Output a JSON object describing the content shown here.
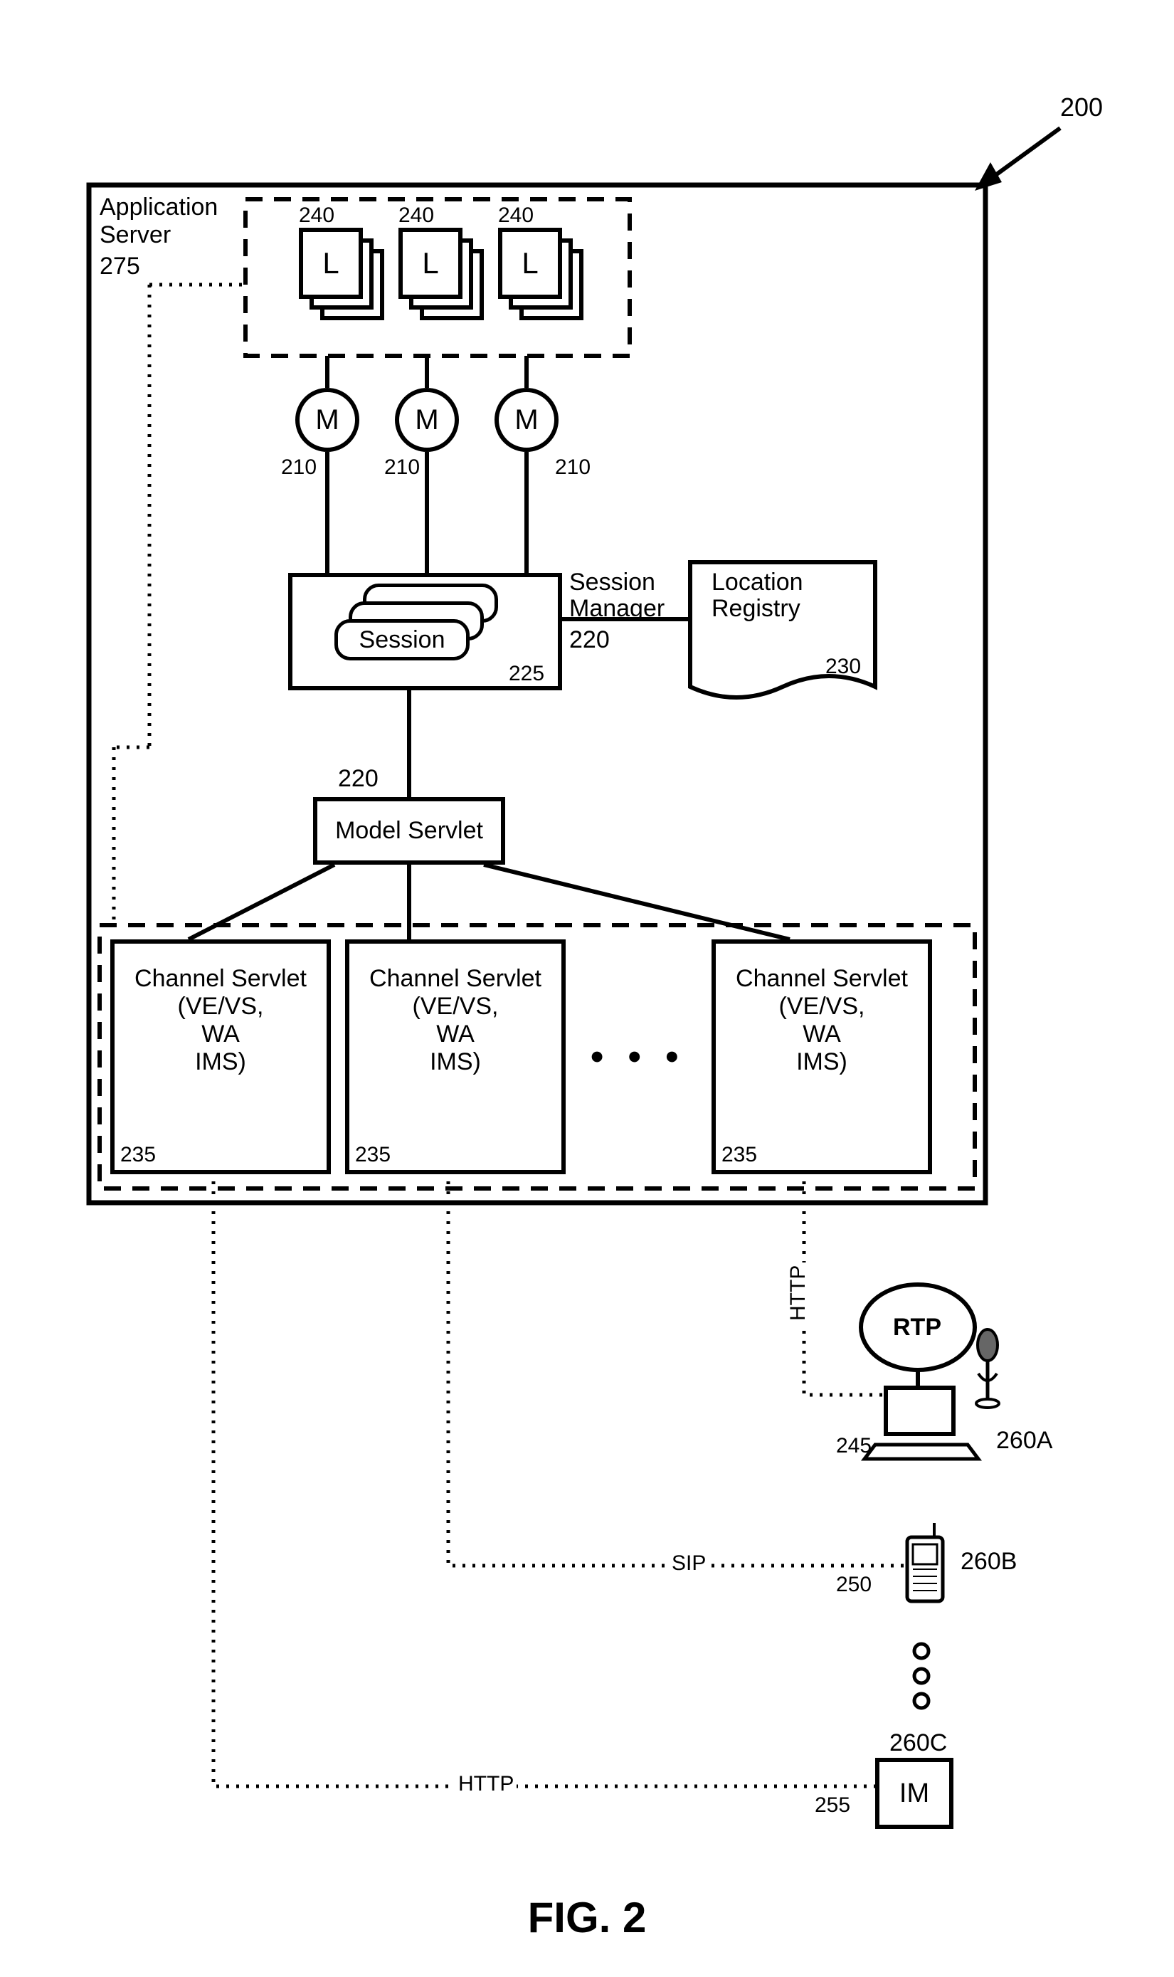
{
  "fig_ref": "200",
  "figure_label": "FIG. 2",
  "app_server": {
    "label": "Application\nServer",
    "ref": "275"
  },
  "listeners": {
    "letter": "L",
    "ref": "240"
  },
  "mediators": {
    "letter": "M",
    "ref": "210"
  },
  "session_manager": {
    "label": "Session\nManager",
    "ref": "220",
    "session_label": "Session",
    "session_ref": "225"
  },
  "location_registry": {
    "label": "Location\nRegistry",
    "ref": "230"
  },
  "model_servlet": {
    "label": "Model Servlet",
    "ref": "220"
  },
  "channel_servlet": {
    "title": "Channel Servlet",
    "line2": "(VE/VS,",
    "line3": "WA",
    "line4": "IMS)",
    "ref": "235"
  },
  "ellipsis_blocks": "• • •",
  "ellipsis_devices": "○\n○\n○",
  "protocols": {
    "http": "HTTP",
    "sip": "SIP"
  },
  "devices": {
    "rtp": "RTP",
    "d1_ref": "245",
    "d1_tag": "260A",
    "d2_ref": "250",
    "d2_tag": "260B",
    "d3_ref": "255",
    "d3_tag": "260C",
    "im": "IM"
  }
}
